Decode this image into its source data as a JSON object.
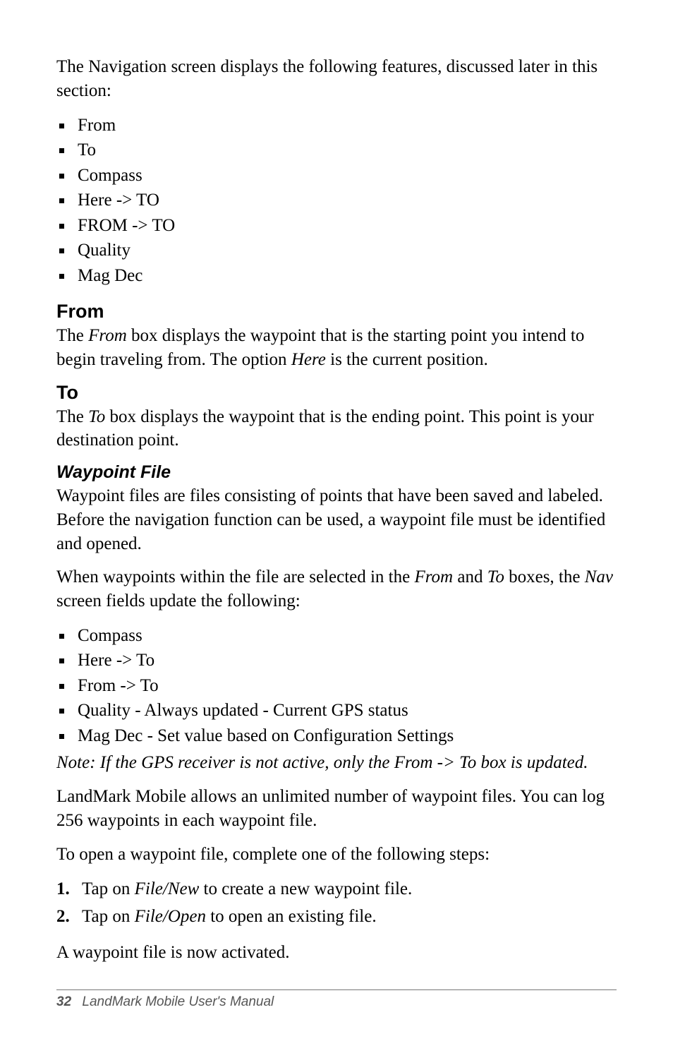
{
  "intro": "The Navigation screen displays the following features, discussed later in this section:",
  "feature_list": [
    "From",
    "To",
    "Compass",
    "Here -> TO",
    "FROM -> TO",
    "Quality",
    "Mag Dec"
  ],
  "from_section": {
    "heading": "From",
    "body_pre": "The ",
    "body_ital1": "From",
    "body_mid": " box displays the waypoint that is the starting point you intend to begin traveling from. The option ",
    "body_ital2": "Here",
    "body_post": " is the current position."
  },
  "to_section": {
    "heading": "To",
    "body_pre": "The ",
    "body_ital": "To",
    "body_post": " box displays the waypoint that is the ending point. This point is your destination point."
  },
  "waypoint_section": {
    "heading": "Waypoint File",
    "para1": "Waypoint files are files consisting of points that have been saved and labeled. Before the navigation function can be used, a waypoint file must be identified and opened.",
    "para2_pre": "When waypoints within the file are selected in the ",
    "para2_ital1": "From",
    "para2_mid1": " and ",
    "para2_ital2": "To",
    "para2_mid2": " boxes, the ",
    "para2_ital3": "Nav",
    "para2_post": " screen fields update the following:",
    "list": [
      "Compass",
      "Here -> To",
      "From -> To",
      "Quality - Always updated - Current GPS status",
      "Mag Dec - Set value based on Configuration Settings"
    ],
    "note": "Note: If the GPS receiver is not active, only the From -> To box is updated.",
    "para3": "LandMark Mobile allows an unlimited number of waypoint files. You can log 256 waypoints in each waypoint file.",
    "para4": "To open a waypoint file, complete one of the following steps:",
    "steps": [
      {
        "num": "1.",
        "pre": "Tap on ",
        "ital": "File/New",
        "post": " to create a new waypoint file."
      },
      {
        "num": "2.",
        "pre": "Tap on ",
        "ital": "File/Open",
        "post": " to open an existing file."
      }
    ],
    "para5": "A waypoint file is now activated."
  },
  "footer": {
    "page": "32",
    "title": "LandMark Mobile User's Manual"
  }
}
